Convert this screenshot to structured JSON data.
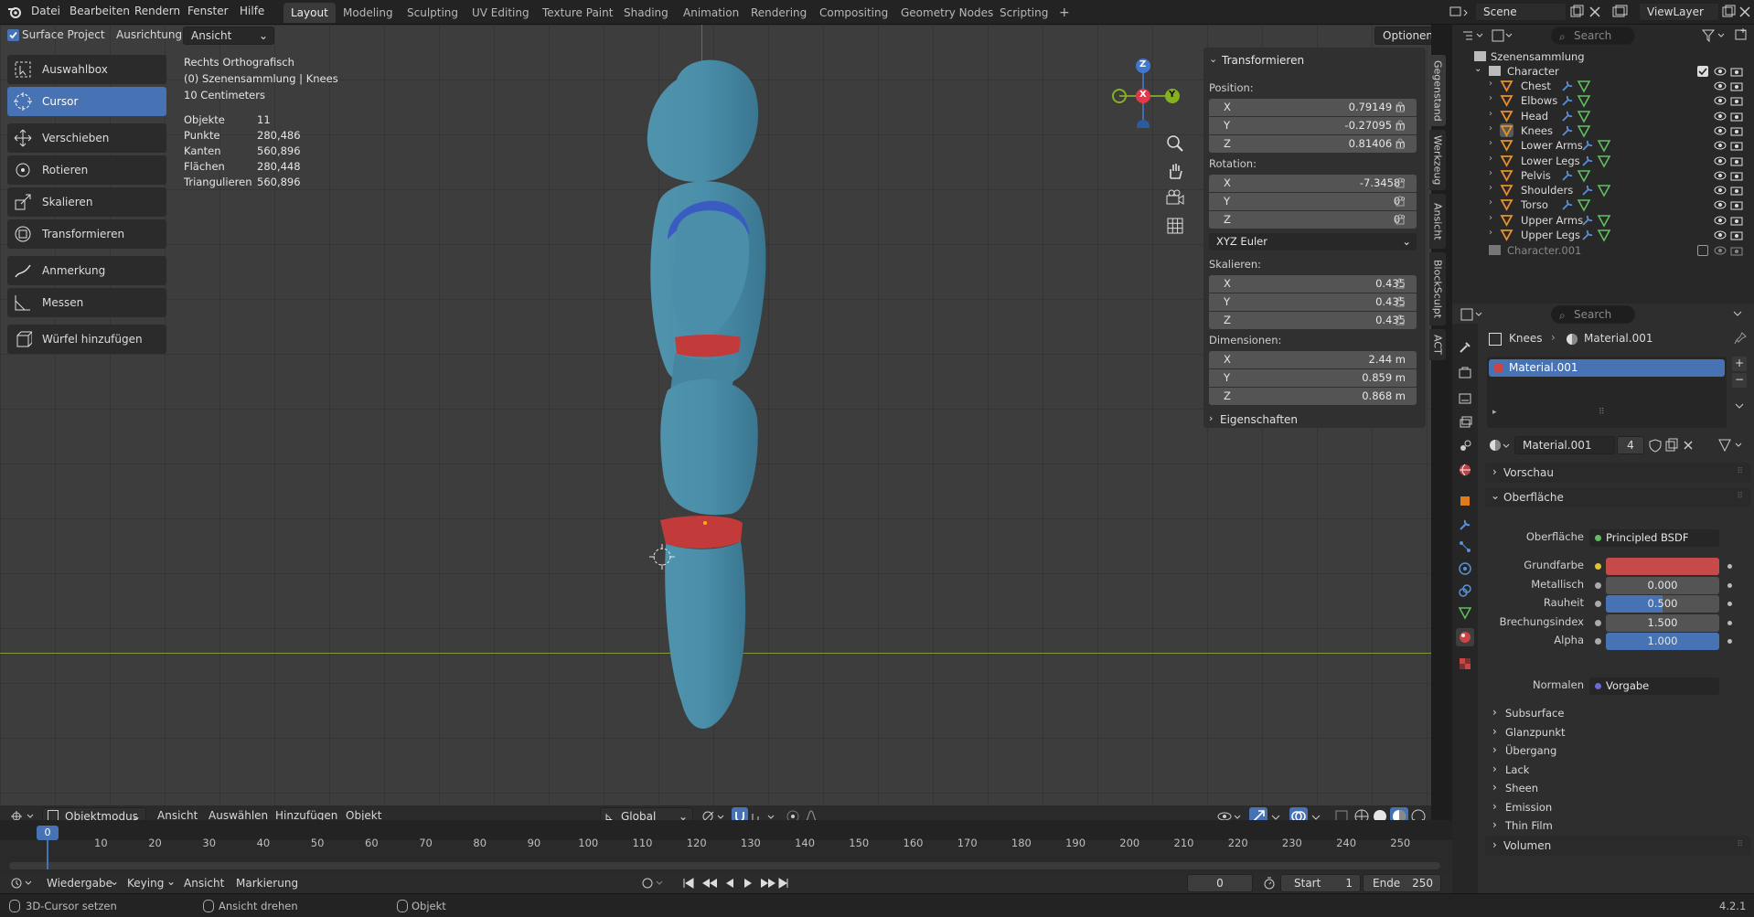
{
  "topbar": {
    "menu": [
      "Datei",
      "Bearbeiten",
      "Rendern",
      "Fenster",
      "Hilfe"
    ],
    "workspaces": [
      "Layout",
      "Modeling",
      "Sculpting",
      "UV Editing",
      "Texture Paint",
      "Shading",
      "Animation",
      "Rendering",
      "Compositing",
      "Geometry Nodes",
      "Scripting"
    ],
    "active_workspace": "Layout",
    "add_tab": "+",
    "scene_label": "Scene",
    "viewlayer_label": "ViewLayer"
  },
  "header": {
    "surface_project": "Surface Project",
    "ausrichtung_label": "Ausrichtung:",
    "ausrichtung_value": "Ansicht",
    "optionen": "Optionen"
  },
  "tools": {
    "auswahlbox": "Auswahlbox",
    "cursor": "Cursor",
    "verschieben": "Verschieben",
    "rotieren": "Rotieren",
    "skalieren": "Skalieren",
    "transformieren": "Transformieren",
    "anmerkung": "Anmerkung",
    "messen": "Messen",
    "wuerfel": "Würfel hinzufügen"
  },
  "overlay": {
    "view_name": "Rechts Orthografisch",
    "collection": "(0) Szenensammlung | Knees",
    "scale": "10 Centimeters",
    "stats": [
      {
        "k": "Objekte",
        "v": "11"
      },
      {
        "k": "Punkte",
        "v": "280,486"
      },
      {
        "k": "Kanten",
        "v": "560,896"
      },
      {
        "k": "Flächen",
        "v": "280,448"
      },
      {
        "k": "Triangulieren",
        "v": "560,896"
      }
    ]
  },
  "gizmo": {
    "z": "Z",
    "x": "X",
    "y": "Y"
  },
  "npanel": {
    "title": "Transformieren",
    "position_label": "Position:",
    "position": [
      {
        "k": "X",
        "v": "0.79149 m"
      },
      {
        "k": "Y",
        "v": "-0.27095 m"
      },
      {
        "k": "Z",
        "v": "0.81406 m"
      }
    ],
    "rotation_label": "Rotation:",
    "rotation": [
      {
        "k": "X",
        "v": "-7.3458°"
      },
      {
        "k": "Y",
        "v": "0°"
      },
      {
        "k": "Z",
        "v": "0°"
      }
    ],
    "rotation_mode": "XYZ Euler",
    "scale_label": "Skalieren:",
    "scale": [
      {
        "k": "X",
        "v": "0.435"
      },
      {
        "k": "Y",
        "v": "0.435"
      },
      {
        "k": "Z",
        "v": "0.435"
      }
    ],
    "dimensions_label": "Dimensionen:",
    "dimensions": [
      {
        "k": "X",
        "v": "2.44 m"
      },
      {
        "k": "Y",
        "v": "0.859 m"
      },
      {
        "k": "Z",
        "v": "0.868 m"
      }
    ],
    "properties": "Eigenschaften"
  },
  "side_tabs": [
    "Gegenstand",
    "Werkzeug",
    "Ansicht",
    "BlockSculpt",
    "ACT"
  ],
  "outliner": {
    "search_placeholder": "Search",
    "root": "Szenensammlung",
    "collection": "Character",
    "items": [
      "Chest",
      "Elbows",
      "Head",
      "Knees",
      "Lower Arms",
      "Lower Legs",
      "Pelvis",
      "Shoulders",
      "Torso",
      "Upper Arms",
      "Upper Legs"
    ],
    "selected": "Knees",
    "collection2": "Character.001"
  },
  "properties": {
    "search_placeholder": "Search",
    "breadcrumb_object": "Knees",
    "breadcrumb_material": "Material.001",
    "slot": "Material.001",
    "material_name": "Material.001",
    "users": "4",
    "vorschau": "Vorschau",
    "oberflaeche_section": "Oberfläche",
    "oberflaeche_label": "Oberfläche",
    "shader": "Principled BSDF",
    "fields": [
      {
        "k": "Grundfarbe",
        "v": "",
        "type": "color"
      },
      {
        "k": "Metallisch",
        "v": "0.000",
        "fill": 0
      },
      {
        "k": "Rauheit",
        "v": "0.500",
        "fill": 0.5
      },
      {
        "k": "Brechungsindex",
        "v": "1.500",
        "fill": 0
      },
      {
        "k": "Alpha",
        "v": "1.000",
        "fill": 1
      }
    ],
    "normalen_label": "Normalen",
    "normalen_value": "Vorgabe",
    "subpanels": [
      "Subsurface",
      "Glanzpunkt",
      "Übergang",
      "Lack",
      "Sheen",
      "Emission",
      "Thin Film"
    ],
    "volumen": "Volumen",
    "base_color": "#c74a4a",
    "accent": "#4772b3"
  },
  "viewport_header": {
    "mode": "Objektmodus",
    "menus": [
      "Ansicht",
      "Auswählen",
      "Hinzufügen",
      "Objekt"
    ],
    "orientation": "Global"
  },
  "timeline": {
    "frames": [
      "0",
      "10",
      "20",
      "30",
      "40",
      "50",
      "60",
      "70",
      "80",
      "90",
      "100",
      "110",
      "120",
      "130",
      "140",
      "150",
      "160",
      "170",
      "180",
      "190",
      "200",
      "210",
      "220",
      "230",
      "240",
      "250"
    ],
    "current_frame": "0",
    "playback": "Wiedergabe",
    "keying": "Keying",
    "ansicht": "Ansicht",
    "markierung": "Markierung",
    "frame_field": "0",
    "start_label": "Start",
    "start_value": "1",
    "end_label": "Ende",
    "end_value": "250"
  },
  "status": {
    "left": "3D-Cursor setzen",
    "middle": "Ansicht drehen",
    "right": "Objekt",
    "version": "4.2.1"
  }
}
